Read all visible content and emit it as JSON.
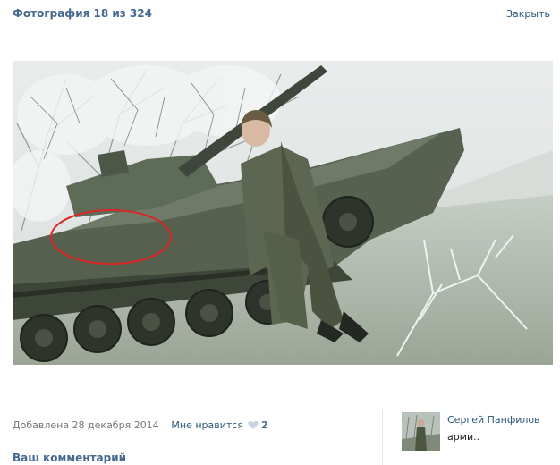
{
  "header": {
    "title": "Фотография 18 из 324",
    "close_label": "Закрыть"
  },
  "photo": {
    "highlight_color": "#d92626"
  },
  "meta": {
    "added_label": "Добавлена 28 декабря 2014",
    "like_label": "Мне нравится",
    "like_count": "2",
    "heart_icon": "heart-icon"
  },
  "comment": {
    "label": "Ваш комментарий"
  },
  "author": {
    "name": "Сергей Панфилов",
    "caption": "арми.."
  }
}
